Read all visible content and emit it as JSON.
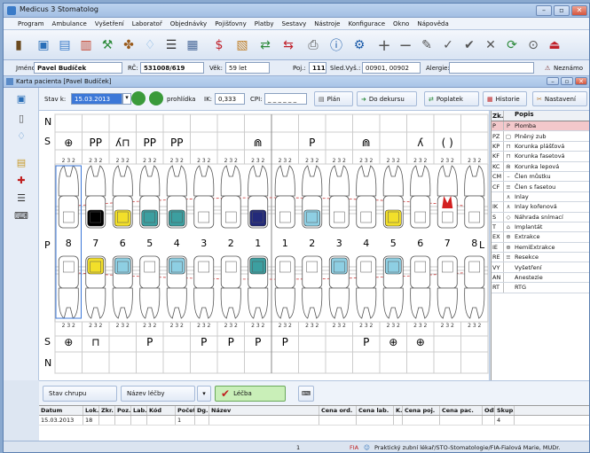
{
  "window": {
    "title": "Medicus 3 Stomatolog"
  },
  "menu": [
    "Program",
    "Ambulance",
    "Vyšetření",
    "Laboratoř",
    "Objednávky",
    "Pojišťovny",
    "Platby",
    "Sestavy",
    "Nástroje",
    "Konfigurace",
    "Okno",
    "Nápověda"
  ],
  "patient": {
    "jmeno_label": "Jméno",
    "jmeno": "Pavel Budíček",
    "rc_label": "RČ:",
    "rc": "531008/619",
    "vek_label": "Věk:",
    "vek": "59 let",
    "poj_label": "Poj.:",
    "poj": "111",
    "sledvys_label": "Sled.Vyš.:",
    "sledvys": "00901, 00902",
    "alergie_label": "Alergie:",
    "neznamo": "Neznámo"
  },
  "card": {
    "title": "Karta pacienta [Pavel Budíček]"
  },
  "controls": {
    "stav_label": "Stav k:",
    "stav_date": "15.03.2013",
    "prohlidka": "prohlídka",
    "ik_label": "IK:",
    "ik_value": "0,333",
    "cpi_label": "CPI:",
    "cpi_value": "_ _ _ _ _ _",
    "plan": "Plán",
    "do_dekursu": "Do dekursu",
    "poplatek": "Poplatek",
    "historie": "Historie",
    "nastaveni": "Nastavení"
  },
  "chart": {
    "upper_numbers": [
      "8",
      "7",
      "6",
      "5",
      "4",
      "3",
      "2",
      "1",
      "1",
      "2",
      "3",
      "4",
      "5",
      "6",
      "7",
      "8"
    ],
    "side_left": "P",
    "side_right": "L",
    "row_n": "N",
    "row_s": "S",
    "upper_status": [
      "⊕",
      "PP",
      "ʎ⊓",
      "PP",
      "PP",
      "",
      "",
      "⋒",
      "",
      "P",
      "",
      "⋒",
      "",
      "ʎ",
      "( )",
      ""
    ],
    "lower_status": [
      "⊕",
      "⊓",
      "",
      "P",
      "",
      "P",
      "P",
      "P",
      "P",
      "",
      "",
      "P",
      "⊕",
      "⊕",
      "",
      ""
    ]
  },
  "legend": {
    "head_zk": "Zk.",
    "head_popis": "Popis",
    "items": [
      {
        "zk": "P",
        "ico": "P",
        "popis": "Plomba"
      },
      {
        "zk": "PZ",
        "ico": "▢",
        "popis": "Plněný zub"
      },
      {
        "zk": "KP",
        "ico": "⊓",
        "popis": "Korunka plášťová"
      },
      {
        "zk": "KF",
        "ico": "⊓",
        "popis": "Korunka fasetová"
      },
      {
        "zk": "KC",
        "ico": "⋒",
        "popis": "Korunka lepová"
      },
      {
        "zk": "CM",
        "ico": "–",
        "popis": "Člen můstku"
      },
      {
        "zk": "CF",
        "ico": "≡",
        "popis": "Člen s fasetou"
      },
      {
        "zk": "",
        "ico": "∧",
        "popis": "Inlay"
      },
      {
        "zk": "IK",
        "ico": "∧",
        "popis": "Inlay kořenová"
      },
      {
        "zk": "S",
        "ico": "◇",
        "popis": "Náhrada snímací"
      },
      {
        "zk": "T",
        "ico": "⌂",
        "popis": "Implantát"
      },
      {
        "zk": "EX",
        "ico": "⊕",
        "popis": "Extrakce"
      },
      {
        "zk": "IE",
        "ico": "⊕",
        "popis": "HemiExtrakce"
      },
      {
        "zk": "RE",
        "ico": "≡",
        "popis": "Resekce"
      },
      {
        "zk": "VY",
        "ico": "",
        "popis": "Vyšetření"
      },
      {
        "zk": "AN",
        "ico": "",
        "popis": "Anestezie"
      },
      {
        "zk": "RT",
        "ico": "",
        "popis": "RTG"
      }
    ]
  },
  "bottom": {
    "stav_chrupu": "Stav chrupu",
    "nazev_lecby": "Název léčby",
    "lecba": "Léčba"
  },
  "grid": {
    "headers": [
      "Datum",
      "Lok.",
      "Zkr.",
      "Poz.",
      "Lab.",
      "Kód",
      "Počet",
      "Dg.",
      "Název",
      "Cena ord.",
      "Cena lab.",
      "K.",
      "Cena poj.",
      "Cena pac.",
      "Odb.",
      "Skup."
    ],
    "rows": [
      [
        "15.03.2013",
        "18",
        "",
        "",
        "",
        "",
        "1",
        "",
        "",
        "",
        "",
        "",
        "",
        "",
        "",
        "4"
      ]
    ]
  },
  "status": {
    "count": "1",
    "fia": "FIA",
    "doctor": "Praktický zubní lékař/STO-Stomatologie/FIA-Fialová Marie, MUDr."
  },
  "colors": {
    "yellow": "#f2df2a",
    "teal": "#3c9fa0",
    "lightblue": "#8ecfe3",
    "navy": "#232a7a",
    "red": "#d32020",
    "black": "#000000"
  }
}
